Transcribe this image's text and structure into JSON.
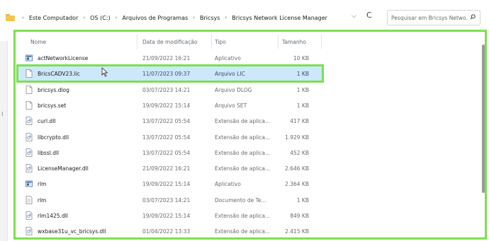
{
  "address_bar": {
    "crumbs": [
      "Este Computador",
      "OS (C:)",
      "Arquivos de Programas",
      "Bricsys",
      "Bricsys Network License Manager"
    ],
    "separator": "›",
    "dropdown_glyph": "⌵",
    "refresh_glyph": "C"
  },
  "search": {
    "placeholder": "Pesquisar em Bricsys Netwo..."
  },
  "columns": {
    "name": "Nome",
    "date": "Data de modificação",
    "type": "Tipo",
    "size": "Tamanho"
  },
  "files": [
    {
      "name": "actNetworkLicense",
      "date": "21/09/2022 16:21",
      "type": "Aplicativo",
      "size": "10 KB",
      "icon": "application-icon"
    },
    {
      "name": "BricsCADV23.lic",
      "date": "11/07/2023 09:37",
      "type": "Arquivo LIC",
      "size": "1 KB",
      "icon": "file-icon",
      "selected": true
    },
    {
      "name": "bricsys.dlog",
      "date": "03/07/2023 14:21",
      "type": "Arquivo DLOG",
      "size": "1 KB",
      "icon": "file-icon"
    },
    {
      "name": "bricsys.set",
      "date": "19/09/2022 15:14",
      "type": "Arquivo SET",
      "size": "1 KB",
      "icon": "file-icon"
    },
    {
      "name": "curl.dll",
      "date": "13/07/2022 05:54",
      "type": "Extensão de aplica...",
      "size": "417 KB",
      "icon": "dll-icon"
    },
    {
      "name": "libcrypto.dll",
      "date": "13/07/2022 05:54",
      "type": "Extensão de aplica...",
      "size": "1.929 KB",
      "icon": "dll-icon"
    },
    {
      "name": "libssl.dll",
      "date": "13/07/2022 05:54",
      "type": "Extensão de aplica...",
      "size": "452 KB",
      "icon": "dll-icon"
    },
    {
      "name": "LicenseManager.dll",
      "date": "21/09/2022 16:21",
      "type": "Extensão de aplica...",
      "size": "2.646 KB",
      "icon": "dll-icon"
    },
    {
      "name": "rlm",
      "date": "19/09/2022 15:14",
      "type": "Aplicativo",
      "size": "2.364 KB",
      "icon": "application-icon"
    },
    {
      "name": "rlm",
      "date": "03/07/2023 14:21",
      "type": "Documento de Te...",
      "size": "1 KB",
      "icon": "text-document-icon"
    },
    {
      "name": "rlm1425.dll",
      "date": "19/09/2022 15:14",
      "type": "Extensão de aplica...",
      "size": "849 KB",
      "icon": "dll-icon"
    },
    {
      "name": "wxbase31u_vc_bricsys.dll",
      "date": "01/04/2022 13:33",
      "type": "Extensão de aplica...",
      "size": "2.415 KB",
      "icon": "dll-icon"
    }
  ],
  "colors": {
    "highlight_border": "#7be04f",
    "selection_bg": "#cde8fb",
    "folder": "#f4c551"
  }
}
